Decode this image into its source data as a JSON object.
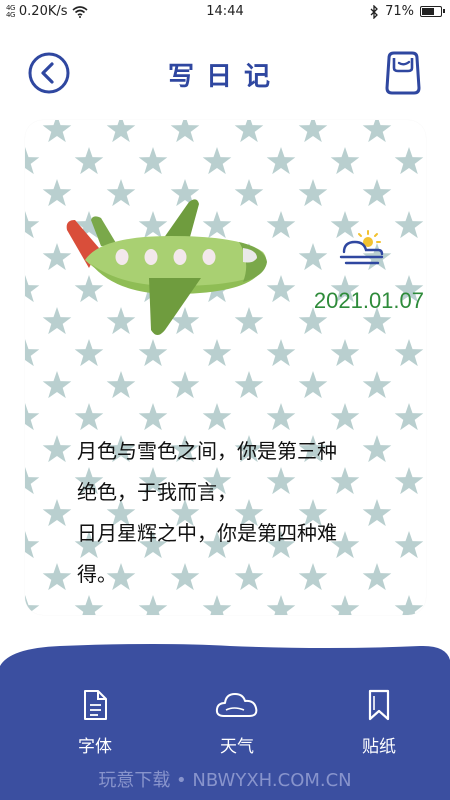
{
  "status_bar": {
    "signal_top": "4G",
    "signal_bottom": "4G",
    "speed": "0.20K/s",
    "time": "14:44",
    "battery_percent": "71%",
    "battery_level": 0.71
  },
  "header": {
    "title": "写日记",
    "back_icon": "back-arrow-icon",
    "save_icon": "save-icon"
  },
  "card": {
    "illustration": "airplane",
    "weather_icon": "sun-behind-cloud-icon",
    "date": "2021.01.07",
    "text": "月色与雪色之间，你是第三种\n绝色，于我而言，\n日月星辉之中，你是第四种难\n得。",
    "colors": {
      "stars": "#b9cfcf",
      "date": "#2e8b3a"
    }
  },
  "toolbar": {
    "items": [
      {
        "label": "字体",
        "icon": "font-icon"
      },
      {
        "label": "天气",
        "icon": "cloud-icon"
      },
      {
        "label": "贴纸",
        "icon": "bookmark-icon"
      }
    ],
    "watermark": "玩意下载 • NBWYXH.COM.CN",
    "background": "#3b4fa0"
  }
}
